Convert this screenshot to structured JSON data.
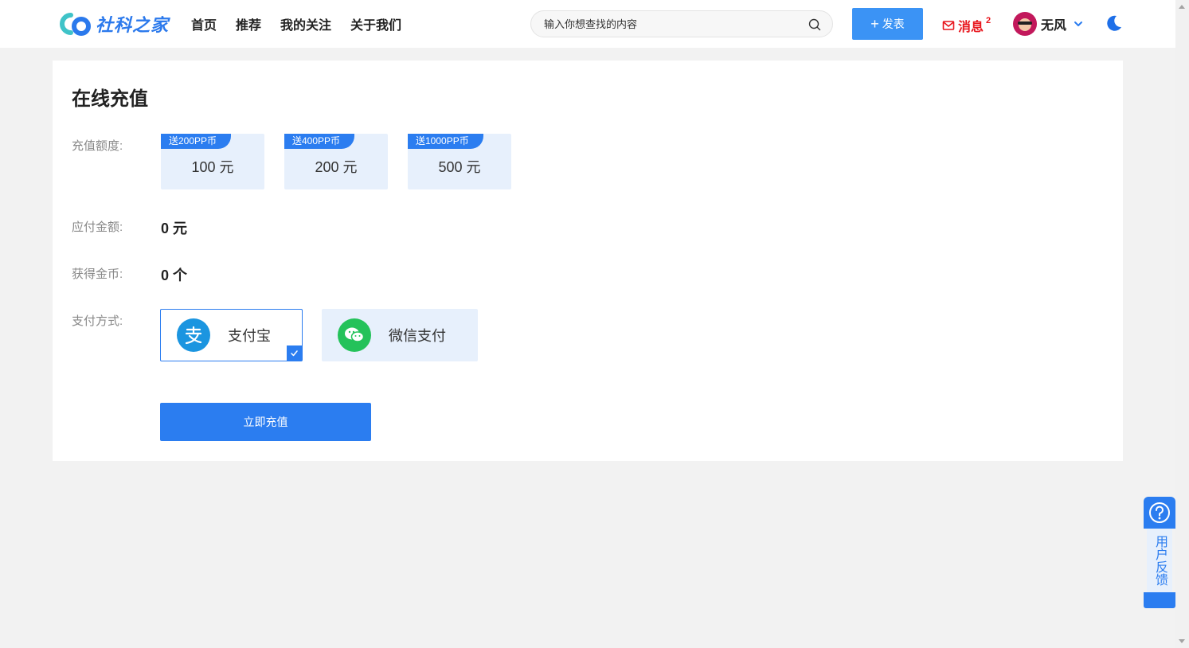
{
  "header": {
    "logo_text": "社科之家",
    "nav": [
      "首页",
      "推荐",
      "我的关注",
      "关于我们"
    ],
    "search_placeholder": "输入你想查找的内容",
    "publish_label": "发表",
    "messages_label": "消息",
    "messages_count": "2",
    "username": "无风"
  },
  "page": {
    "title": "在线充值",
    "amount_label": "充值额度:",
    "amounts": [
      {
        "bonus": "送200PP币",
        "value": "100 元"
      },
      {
        "bonus": "送400PP币",
        "value": "200 元"
      },
      {
        "bonus": "送1000PP币",
        "value": "500 元"
      }
    ],
    "payable_label": "应付金额:",
    "payable_value": "0 元",
    "coins_label": "获得金币:",
    "coins_value": "0 个",
    "method_label": "支付方式:",
    "methods": [
      {
        "label": "支付宝",
        "selected": true,
        "color": "#1b95e0"
      },
      {
        "label": "微信支付",
        "selected": false,
        "color": "#24c25a"
      }
    ],
    "submit_label": "立即充值"
  },
  "feedback": {
    "label": "用户反馈"
  },
  "colors": {
    "primary": "#2b7df0",
    "publish": "#3b93f5",
    "message": "#e8151c",
    "option_bg": "#e7f0fc"
  }
}
